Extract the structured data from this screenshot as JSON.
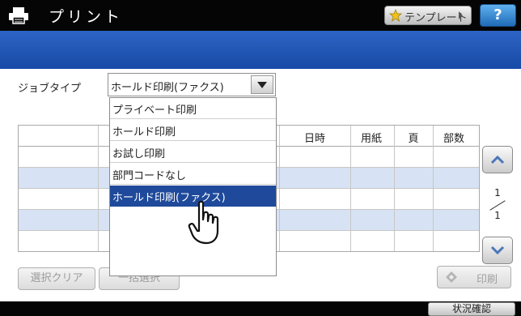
{
  "header": {
    "title": "プリント",
    "template_label": "テンプレート",
    "help_label": "?"
  },
  "jobtype": {
    "label": "ジョブタイプ",
    "selected": "ホールド印刷(ファクス)",
    "options": [
      "プライベート印刷",
      "ホールド印刷",
      "お試し印刷",
      "部門コードなし",
      "ホールド印刷(ファクス)"
    ],
    "selected_index": 4
  },
  "table": {
    "columns": [
      "日時",
      "用紙",
      "頁",
      "部数"
    ],
    "rows": [
      {
        "alt": false
      },
      {
        "alt": true
      },
      {
        "alt": false
      },
      {
        "alt": true
      },
      {
        "alt": false
      }
    ]
  },
  "pager": {
    "current": "1",
    "total": "1"
  },
  "buttons": {
    "clear_selection": "選択クリア",
    "select_all": "一括選択",
    "print": "印刷"
  },
  "statusbar": {
    "status_check": "状況確認"
  },
  "colors": {
    "blue_band": "#2458b8",
    "selected_item": "#1f4a9b",
    "alt_row": "#d7e3f4"
  }
}
